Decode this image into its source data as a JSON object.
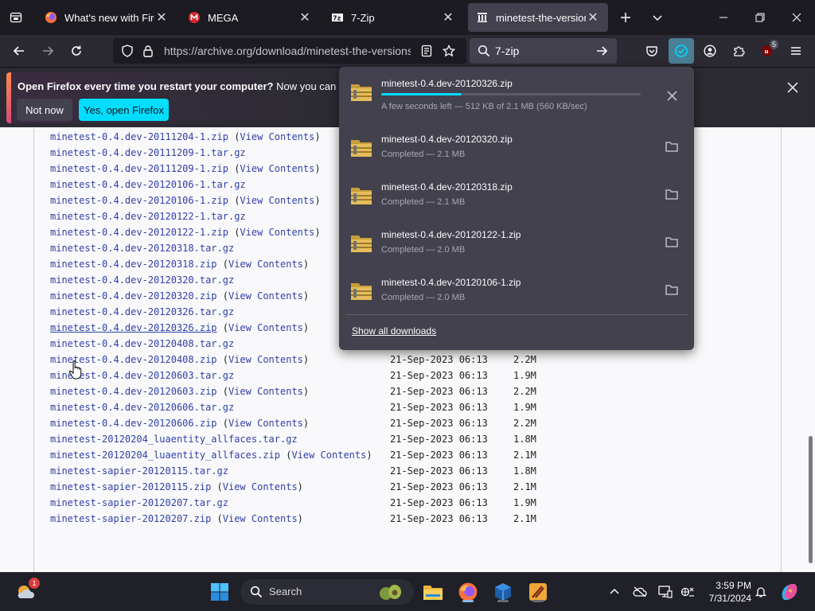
{
  "tabs": [
    {
      "title": "What's new with Firefox",
      "favicon": "firefox-icon",
      "active": false
    },
    {
      "title": "MEGA",
      "favicon": "mega-icon",
      "active": false
    },
    {
      "title": "7-Zip",
      "favicon": "7zip-icon",
      "active": false
    },
    {
      "title": "minetest-the-versions",
      "favicon": "archive-icon",
      "active": true
    }
  ],
  "nav": {
    "url": "https://archive.org/download/minetest-the-versions",
    "search_query": "7-zip",
    "extension_badge": "5"
  },
  "notification": {
    "message_bold": "Open Firefox every time you restart your computer?",
    "message_rest": " Now you can set Firefox to open automatically.",
    "not_now": "Not now",
    "yes": "Yes, open Firefox"
  },
  "downloads": {
    "items": [
      {
        "name": "minetest-0.4.dev-20120326.zip",
        "status": "A few seconds left — 512 KB of 2.1 MB (560 KB/sec)",
        "in_progress": true,
        "progress": 0.31
      },
      {
        "name": "minetest-0.4.dev-20120320.zip",
        "status": "Completed — 2.1 MB",
        "in_progress": false
      },
      {
        "name": "minetest-0.4.dev-20120318.zip",
        "status": "Completed — 2.1 MB",
        "in_progress": false
      },
      {
        "name": "minetest-0.4.dev-20120122-1.zip",
        "status": "Completed — 2.0 MB",
        "in_progress": false
      },
      {
        "name": "minetest-0.4.dev-20120106-1.zip",
        "status": "Completed — 2.0 MB",
        "in_progress": false
      }
    ],
    "show_all": "Show all downloads"
  },
  "files": [
    {
      "name": "minetest-0.4.dev-20111204-1.zip",
      "view": "View Contents",
      "date": "",
      "size": ""
    },
    {
      "name": "minetest-0.4.dev-20111209-1.tar.gz",
      "view": "",
      "date": "",
      "size": ""
    },
    {
      "name": "minetest-0.4.dev-20111209-1.zip",
      "view": "View Contents",
      "date": "",
      "size": ""
    },
    {
      "name": "minetest-0.4.dev-20120106-1.tar.gz",
      "view": "",
      "date": "",
      "size": ""
    },
    {
      "name": "minetest-0.4.dev-20120106-1.zip",
      "view": "View Contents",
      "date": "",
      "size": ""
    },
    {
      "name": "minetest-0.4.dev-20120122-1.tar.gz",
      "view": "",
      "date": "",
      "size": ""
    },
    {
      "name": "minetest-0.4.dev-20120122-1.zip",
      "view": "View Contents",
      "date": "",
      "size": ""
    },
    {
      "name": "minetest-0.4.dev-20120318.tar.gz",
      "view": "",
      "date": "",
      "size": ""
    },
    {
      "name": "minetest-0.4.dev-20120318.zip",
      "view": "View Contents",
      "date": "",
      "size": ""
    },
    {
      "name": "minetest-0.4.dev-20120320.tar.gz",
      "view": "",
      "date": "",
      "size": ""
    },
    {
      "name": "minetest-0.4.dev-20120320.zip",
      "view": "View Contents",
      "date": "",
      "size": ""
    },
    {
      "name": "minetest-0.4.dev-20120326.tar.gz",
      "view": "",
      "date": "",
      "size": ""
    },
    {
      "name": "minetest-0.4.dev-20120326.zip",
      "view": "View Contents",
      "date": "",
      "size": "",
      "underline": true
    },
    {
      "name": "minetest-0.4.dev-20120408.tar.gz",
      "view": "",
      "date": "",
      "size": ""
    },
    {
      "name": "minetest-0.4.dev-20120408.zip",
      "view": "View Contents",
      "date": "21-Sep-2023 06:13",
      "size": "2.2M"
    },
    {
      "name": "minetest-0.4.dev-20120603.tar.gz",
      "view": "",
      "date": "21-Sep-2023 06:13",
      "size": "1.9M"
    },
    {
      "name": "minetest-0.4.dev-20120603.zip",
      "view": "View Contents",
      "date": "21-Sep-2023 06:13",
      "size": "2.2M"
    },
    {
      "name": "minetest-0.4.dev-20120606.tar.gz",
      "view": "",
      "date": "21-Sep-2023 06:13",
      "size": "1.9M"
    },
    {
      "name": "minetest-0.4.dev-20120606.zip",
      "view": "View Contents",
      "date": "21-Sep-2023 06:13",
      "size": "2.2M"
    },
    {
      "name": "minetest-20120204_luaentity_allfaces.tar.gz",
      "view": "",
      "date": "21-Sep-2023 06:13",
      "size": "1.8M"
    },
    {
      "name": "minetest-20120204_luaentity_allfaces.zip",
      "view": "View Contents",
      "date": "21-Sep-2023 06:13",
      "size": "2.1M"
    },
    {
      "name": "minetest-sapier-20120115.tar.gz",
      "view": "",
      "date": "21-Sep-2023 06:13",
      "size": "1.8M"
    },
    {
      "name": "minetest-sapier-20120115.zip",
      "view": "View Contents",
      "date": "21-Sep-2023 06:13",
      "size": "2.1M"
    },
    {
      "name": "minetest-sapier-20120207.tar.gz",
      "view": "",
      "date": "21-Sep-2023 06:13",
      "size": "1.9M"
    },
    {
      "name": "minetest-sapier-20120207.zip",
      "view": "View Contents",
      "date": "21-Sep-2023 06:13",
      "size": "2.1M"
    }
  ],
  "taskbar": {
    "search_placeholder": "Search",
    "time": "3:59 PM",
    "date": "7/31/2024",
    "weather_badge": "1"
  },
  "colors": {
    "link": "#2f41a8",
    "accent": "#00ddff",
    "panel": "#42414d"
  }
}
